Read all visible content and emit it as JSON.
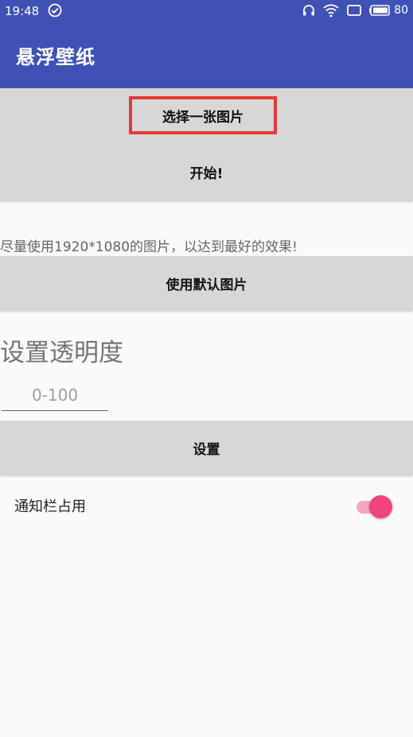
{
  "status_bar": {
    "time": "19:48",
    "battery": "80",
    "icons": [
      "check-circle-icon",
      "headphones-icon",
      "wifi-icon",
      "screen-icon",
      "battery-icon"
    ]
  },
  "app_bar": {
    "title": "悬浮壁纸",
    "color": "#3f51b5"
  },
  "buttons": {
    "select_image": "选择一张图片",
    "start": "开始!",
    "use_default": "使用默认图片",
    "set": "设置"
  },
  "hint": "尽量使用1920*1080的图片，以达到最好的效果!",
  "transparency": {
    "title": "设置透明度",
    "placeholder": "0-100",
    "value": ""
  },
  "notification": {
    "label": "通知栏占用",
    "enabled": true,
    "accent": "#f0437a"
  },
  "highlight_color": "#e53935"
}
